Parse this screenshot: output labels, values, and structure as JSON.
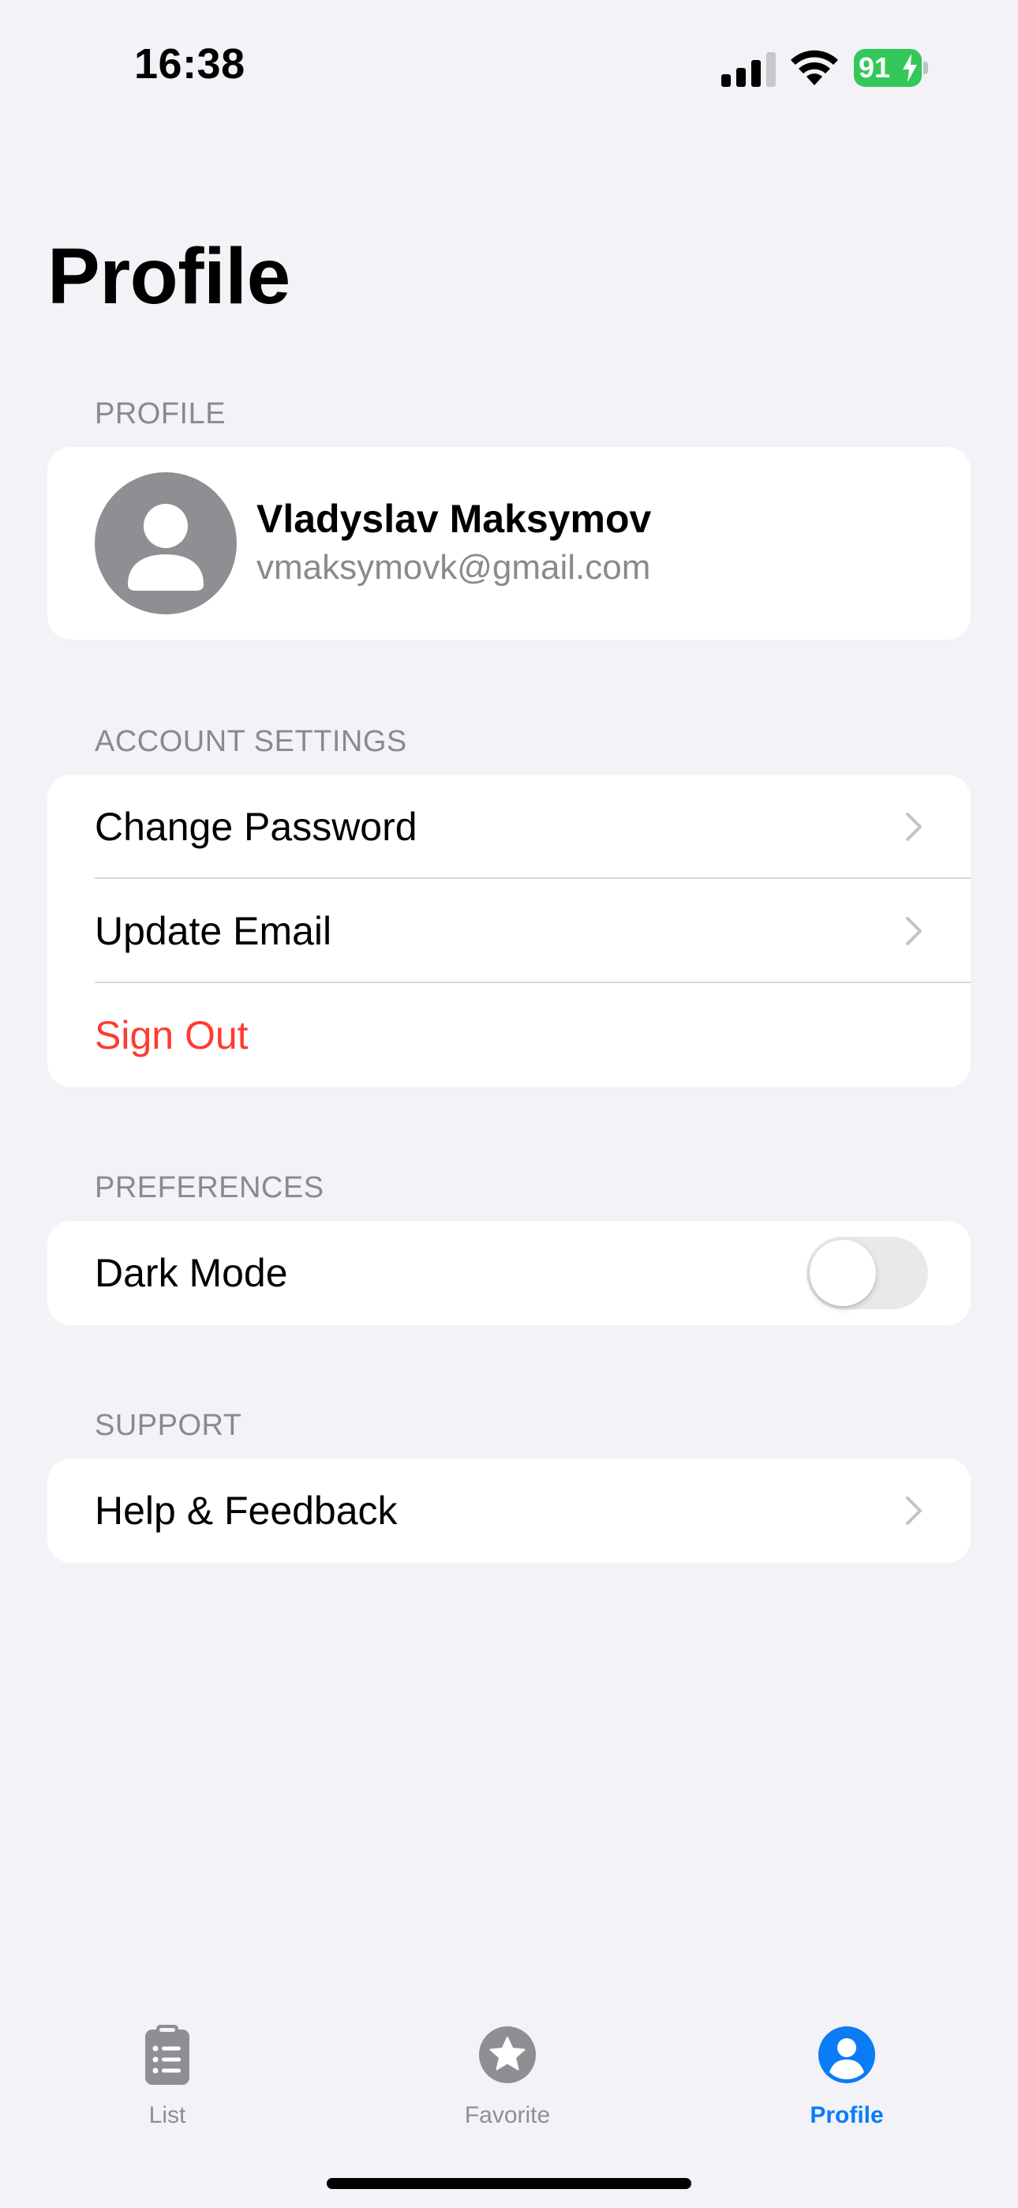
{
  "status_bar": {
    "time": "16:38",
    "battery": "91",
    "signal_icon": "signal-bars-icon",
    "wifi_icon": "wifi-icon",
    "battery_icon": "battery-charging-icon",
    "battery_color": "#34c759"
  },
  "page": {
    "title": "Profile"
  },
  "profile_section": {
    "header": "PROFILE",
    "avatar_icon": "person-icon",
    "name": "Vladyslav Maksymov",
    "email": "vmaksymovk@gmail.com"
  },
  "account_section": {
    "header": "ACCOUNT SETTINGS",
    "items": [
      {
        "label": "Change Password",
        "icon": "chevron-right-icon"
      },
      {
        "label": "Update Email",
        "icon": "chevron-right-icon"
      },
      {
        "label": "Sign Out",
        "color": "#ff3b30"
      }
    ]
  },
  "preferences_section": {
    "header": "PREFERENCES",
    "dark_mode": {
      "label": "Dark Mode",
      "enabled": false
    }
  },
  "support_section": {
    "header": "SUPPORT",
    "items": [
      {
        "label": "Help & Feedback",
        "icon": "chevron-right-icon"
      }
    ]
  },
  "tab_bar": {
    "accent_color": "#0a7cf5",
    "tabs": [
      {
        "label": "List",
        "icon": "clipboard-list-icon",
        "active": false
      },
      {
        "label": "Favorite",
        "icon": "star-circle-icon",
        "active": false
      },
      {
        "label": "Profile",
        "icon": "person-circle-icon",
        "active": true
      }
    ]
  }
}
